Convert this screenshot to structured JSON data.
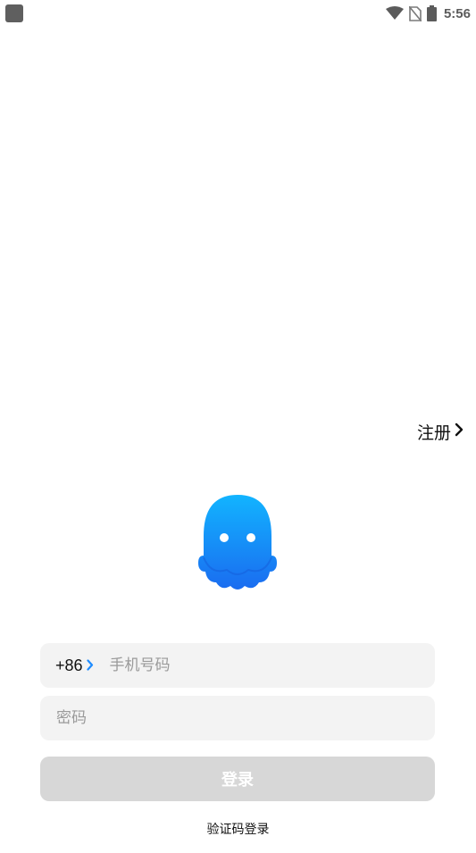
{
  "status_bar": {
    "time": "5:56",
    "icons": [
      "app-indicator-icon",
      "wifi-icon",
      "no-sim-icon",
      "battery-icon"
    ]
  },
  "header": {
    "register_label": "注册"
  },
  "logo": {
    "icon": "octopus-logo-icon",
    "color": "#1e8cff"
  },
  "form": {
    "country_code": "+86",
    "phone_placeholder": "手机号码",
    "password_placeholder": "密码",
    "login_label": "登录",
    "sms_login_label": "验证码登录"
  },
  "colors": {
    "accent": "#1e8cff",
    "field_bg": "#f3f3f3",
    "button_disabled": "#d7d7d7"
  }
}
